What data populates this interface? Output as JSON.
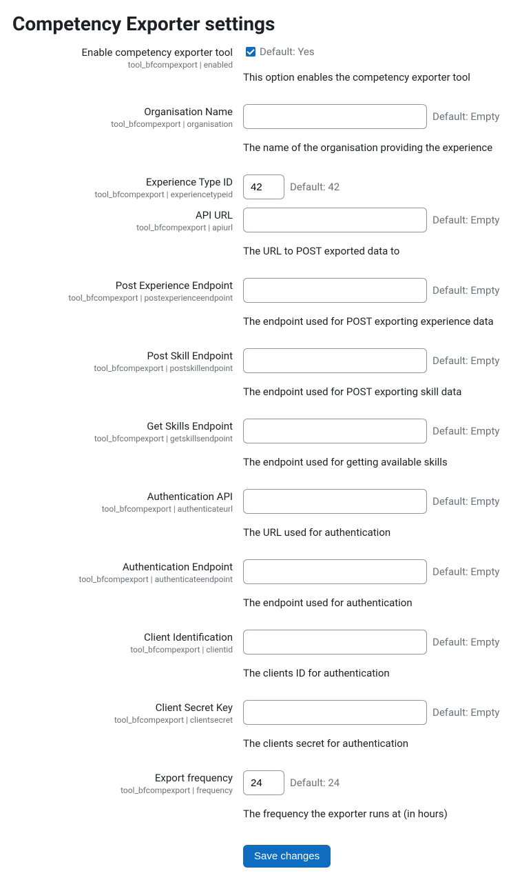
{
  "title": "Competency Exporter settings",
  "rows": [
    {
      "label": "Enable competency exporter tool",
      "key": "tool_bfcompexport | enabled",
      "type": "checkbox",
      "checked": true,
      "default": "Default: Yes",
      "desc": "This option enables the competency exporter tool"
    },
    {
      "label": "Organisation Name",
      "key": "tool_bfcompexport | organisation",
      "type": "text",
      "value": "",
      "size": "full",
      "default": "Default: Empty",
      "desc": "The name of the organisation providing the experience"
    },
    {
      "label": "Experience Type ID",
      "key": "tool_bfcompexport | experiencetypeid",
      "type": "text",
      "value": "42",
      "size": "small",
      "default": "Default: 42",
      "desc": ""
    },
    {
      "label": "API URL",
      "key": "tool_bfcompexport | apiurl",
      "type": "text",
      "value": "",
      "size": "full",
      "default": "Default: Empty",
      "desc": "The URL to POST exported data to"
    },
    {
      "label": "Post Experience Endpoint",
      "key": "tool_bfcompexport | postexperienceendpoint",
      "type": "text",
      "value": "",
      "size": "full",
      "default": "Default: Empty",
      "desc": "The endpoint used for POST exporting experience data"
    },
    {
      "label": "Post Skill Endpoint",
      "key": "tool_bfcompexport | postskillendpoint",
      "type": "text",
      "value": "",
      "size": "full",
      "default": "Default: Empty",
      "desc": "The endpoint used for POST exporting skill data"
    },
    {
      "label": "Get Skills Endpoint",
      "key": "tool_bfcompexport | getskillsendpoint",
      "type": "text",
      "value": "",
      "size": "full",
      "default": "Default: Empty",
      "desc": "The endpoint used for getting available skills"
    },
    {
      "label": "Authentication API",
      "key": "tool_bfcompexport | authenticateurl",
      "type": "text",
      "value": "",
      "size": "full",
      "default": "Default: Empty",
      "desc": "The URL used for authentication"
    },
    {
      "label": "Authentication Endpoint",
      "key": "tool_bfcompexport | authenticateendpoint",
      "type": "text",
      "value": "",
      "size": "full",
      "default": "Default: Empty",
      "desc": "The endpoint used for authentication"
    },
    {
      "label": "Client Identification",
      "key": "tool_bfcompexport | clientid",
      "type": "text",
      "value": "",
      "size": "full",
      "default": "Default: Empty",
      "desc": "The clients ID for authentication"
    },
    {
      "label": "Client Secret Key",
      "key": "tool_bfcompexport | clientsecret",
      "type": "text",
      "value": "",
      "size": "full",
      "default": "Default: Empty",
      "desc": "The clients secret for authentication"
    },
    {
      "label": "Export frequency",
      "key": "tool_bfcompexport | frequency",
      "type": "text",
      "value": "24",
      "size": "small",
      "default": "Default: 24",
      "desc": "The frequency the exporter runs at (in hours)"
    }
  ],
  "saveLabel": "Save changes"
}
